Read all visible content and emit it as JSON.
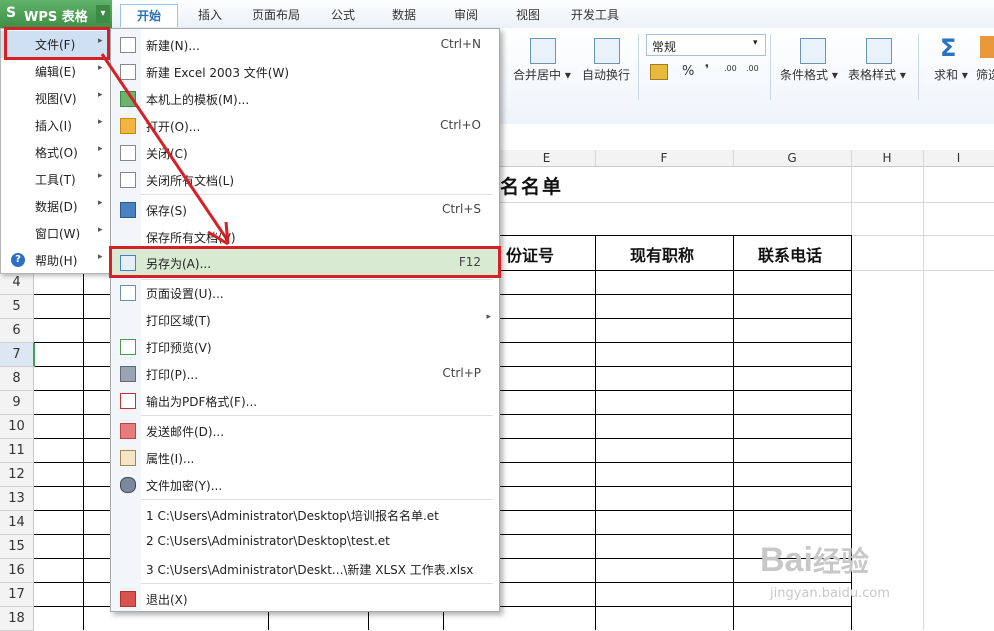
{
  "app": {
    "logo": "S",
    "name": "WPS 表格",
    "dropdown_arrow": "▾"
  },
  "tabs": [
    {
      "label": "开始",
      "active": true
    },
    {
      "label": "插入"
    },
    {
      "label": "页面布局"
    },
    {
      "label": "公式"
    },
    {
      "label": "数据"
    },
    {
      "label": "审阅"
    },
    {
      "label": "视图"
    },
    {
      "label": "开发工具"
    }
  ],
  "ribbon": {
    "merge_center": "合并居中",
    "wrap_text": "自动换行",
    "number_format": "常规",
    "percent": "%",
    "thousands": "❜",
    "inc_decimal": ".00",
    "dec_decimal": ".00",
    "cond_format": "条件格式",
    "table_style": "表格样式",
    "sum": "求和",
    "filter": "筛选",
    "dd": "▾",
    "sigma": "Σ"
  },
  "sheet": {
    "columns": [
      "E",
      "F",
      "G",
      "H",
      "I"
    ],
    "rows": [
      "4",
      "5",
      "6",
      "7",
      "8",
      "9",
      "10",
      "11",
      "12",
      "13",
      "14",
      "15",
      "16",
      "17",
      "18"
    ],
    "title_partial": "名名单",
    "headers": [
      "份证号",
      "现有职称",
      "联系电话"
    ]
  },
  "side_menu": [
    {
      "label": "文件(F)",
      "chevron": "▸"
    },
    {
      "label": "编辑(E)",
      "chevron": "▸"
    },
    {
      "label": "视图(V)",
      "chevron": "▸"
    },
    {
      "label": "插入(I)",
      "chevron": "▸"
    },
    {
      "label": "格式(O)",
      "chevron": "▸"
    },
    {
      "label": "工具(T)",
      "chevron": "▸"
    },
    {
      "label": "数据(D)",
      "chevron": "▸"
    },
    {
      "label": "窗口(W)",
      "chevron": "▸"
    },
    {
      "label": "帮助(H)",
      "chevron": "▸"
    }
  ],
  "file_menu": {
    "new": {
      "label": "新建(N)...",
      "shortcut": "Ctrl+N"
    },
    "new_2003": {
      "label": "新建 Excel 2003 文件(W)"
    },
    "templates": {
      "label": "本机上的模板(M)..."
    },
    "open": {
      "label": "打开(O)...",
      "shortcut": "Ctrl+O"
    },
    "close": {
      "label": "关闭(C)"
    },
    "close_all": {
      "label": "关闭所有文档(L)"
    },
    "save": {
      "label": "保存(S)",
      "shortcut": "Ctrl+S"
    },
    "save_all": {
      "label": "保存所有文档(V)"
    },
    "save_as": {
      "label": "另存为(A)...",
      "shortcut": "F12"
    },
    "page_setup": {
      "label": "页面设置(U)..."
    },
    "print_area": {
      "label": "打印区域(T)",
      "chevron": "▸"
    },
    "print_preview": {
      "label": "打印预览(V)"
    },
    "print": {
      "label": "打印(P)...",
      "shortcut": "Ctrl+P"
    },
    "export_pdf": {
      "label": "输出为PDF格式(F)..."
    },
    "send_mail": {
      "label": "发送邮件(D)..."
    },
    "properties": {
      "label": "属性(I)..."
    },
    "encrypt": {
      "label": "文件加密(Y)..."
    },
    "recent": [
      "1 C:\\Users\\Administrator\\Desktop\\培训报名名单.et",
      "2 C:\\Users\\Administrator\\Desktop\\test.et",
      "3 C:\\Users\\Administrator\\Deskt...\\新建 XLSX 工作表.xlsx"
    ],
    "exit": {
      "label": "退出(X)"
    }
  },
  "watermark": {
    "brand": "Bai",
    "brand2": "经验",
    "url": "jingyan.baidu.com"
  },
  "colors": {
    "highlight_red": "#d42026",
    "wps_green": "#4fa257",
    "save_as_bg": "#d8ead1"
  }
}
